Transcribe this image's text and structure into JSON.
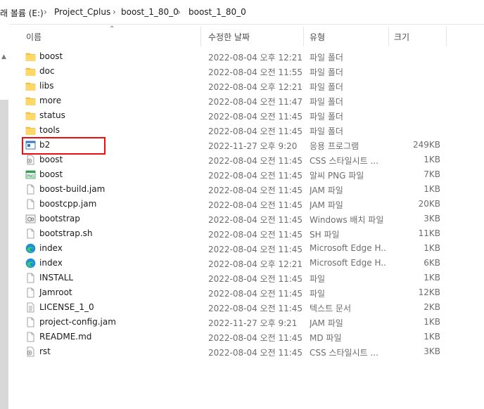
{
  "breadcrumb": {
    "items": [
      "래 볼륨 (E:)",
      "Project_Cplus",
      "boost_1_80_0",
      "boost_1_80_0"
    ],
    "separator": "›"
  },
  "columns": {
    "name": "이름",
    "date": "수정한 날짜",
    "type": "유형",
    "size": "크기"
  },
  "files": [
    {
      "name": "boost",
      "date": "2022-08-04 오후 12:21",
      "type": "파일 폴더",
      "size": "",
      "icon": "folder-icon"
    },
    {
      "name": "doc",
      "date": "2022-08-04 오전 11:55",
      "type": "파일 폴더",
      "size": "",
      "icon": "folder-icon"
    },
    {
      "name": "libs",
      "date": "2022-08-04 오후 12:21",
      "type": "파일 폴더",
      "size": "",
      "icon": "folder-icon"
    },
    {
      "name": "more",
      "date": "2022-08-04 오전 11:47",
      "type": "파일 폴더",
      "size": "",
      "icon": "folder-icon"
    },
    {
      "name": "status",
      "date": "2022-08-04 오전 11:45",
      "type": "파일 폴더",
      "size": "",
      "icon": "folder-icon"
    },
    {
      "name": "tools",
      "date": "2022-08-04 오전 11:45",
      "type": "파일 폴더",
      "size": "",
      "icon": "folder-icon"
    },
    {
      "name": "b2",
      "date": "2022-11-27 오후 9:20",
      "type": "응용 프로그램",
      "size": "249KB",
      "icon": "application-icon"
    },
    {
      "name": "boost",
      "date": "2022-08-04 오전 11:45",
      "type": "CSS 스타일시트 ...",
      "size": "1KB",
      "icon": "css-file-icon"
    },
    {
      "name": "boost",
      "date": "2022-08-04 오전 11:45",
      "type": "알씨 PNG 파일",
      "size": "7KB",
      "icon": "png-file-icon"
    },
    {
      "name": "boost-build.jam",
      "date": "2022-08-04 오전 11:45",
      "type": "JAM 파일",
      "size": "1KB",
      "icon": "file-icon"
    },
    {
      "name": "boostcpp.jam",
      "date": "2022-08-04 오전 11:45",
      "type": "JAM 파일",
      "size": "20KB",
      "icon": "file-icon"
    },
    {
      "name": "bootstrap",
      "date": "2022-08-04 오전 11:45",
      "type": "Windows 배치 파일",
      "size": "3KB",
      "icon": "batch-file-icon"
    },
    {
      "name": "bootstrap.sh",
      "date": "2022-08-04 오전 11:45",
      "type": "SH 파일",
      "size": "11KB",
      "icon": "file-icon"
    },
    {
      "name": "index",
      "date": "2022-08-04 오전 11:45",
      "type": "Microsoft Edge H...",
      "size": "1KB",
      "icon": "edge-icon"
    },
    {
      "name": "index",
      "date": "2022-08-04 오후 12:21",
      "type": "Microsoft Edge H...",
      "size": "6KB",
      "icon": "edge-icon"
    },
    {
      "name": "INSTALL",
      "date": "2022-08-04 오전 11:45",
      "type": "파일",
      "size": "1KB",
      "icon": "file-icon"
    },
    {
      "name": "Jamroot",
      "date": "2022-08-04 오전 11:45",
      "type": "파일",
      "size": "12KB",
      "icon": "file-icon"
    },
    {
      "name": "LICENSE_1_0",
      "date": "2022-08-04 오전 11:45",
      "type": "텍스트 문서",
      "size": "2KB",
      "icon": "text-file-icon"
    },
    {
      "name": "project-config.jam",
      "date": "2022-11-27 오후 9:21",
      "type": "JAM 파일",
      "size": "1KB",
      "icon": "file-icon"
    },
    {
      "name": "README.md",
      "date": "2022-08-04 오전 11:45",
      "type": "MD 파일",
      "size": "1KB",
      "icon": "file-icon"
    },
    {
      "name": "rst",
      "date": "2022-08-04 오전 11:45",
      "type": "CSS 스타일시트 ...",
      "size": "3KB",
      "icon": "css-file-icon"
    }
  ],
  "highlight_color": "#e81010",
  "folder_color": "#f5c242"
}
